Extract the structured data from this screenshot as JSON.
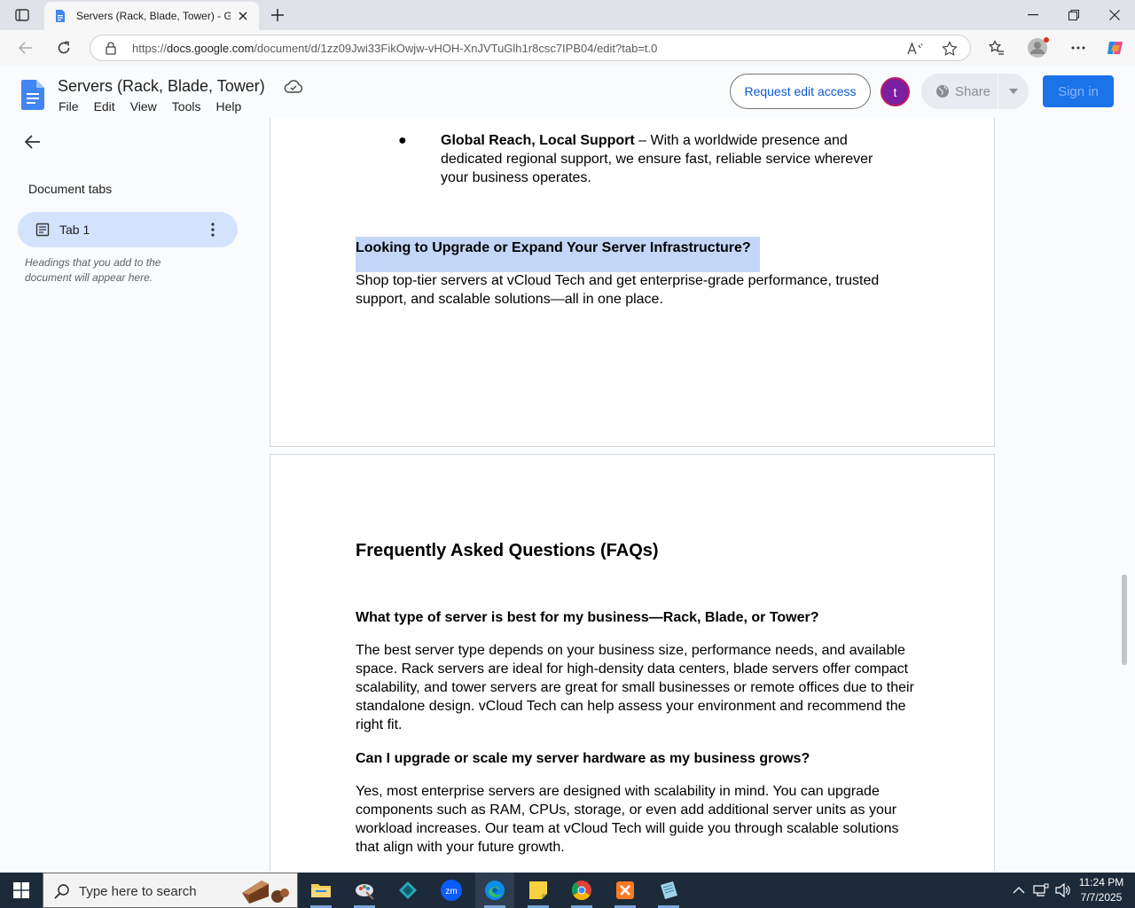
{
  "browser": {
    "tab_title": "Servers (Rack, Blade, Tower) - Goo",
    "url_prefix": "https://",
    "url_host": "docs.google.com",
    "url_path": "/document/d/1zz09Jwi33FikOwjw-vHOH-XnJVTuGlh1r8csc7IPB04/edit?tab=t.0"
  },
  "docs": {
    "title": "Servers (Rack, Blade, Tower)",
    "menu": [
      "File",
      "Edit",
      "View",
      "Tools",
      "Help"
    ],
    "request_edit_label": "Request edit access",
    "avatar_letter": "t",
    "share_label": "Share",
    "signin_label": "Sign in"
  },
  "sidebar": {
    "heading": "Document tabs",
    "tab_label": "Tab 1",
    "hint": "Headings that you add to the document will appear here."
  },
  "page1": {
    "bullet_glyph": "●",
    "bullet_bold": "Global Reach, Local Support",
    "bullet_text": " – With a worldwide presence and dedicated regional support, we ensure fast, reliable service wherever your business operates.",
    "heading": "Looking to Upgrade or Expand Your Server Infrastructure?",
    "body": "Shop top-tier servers at vCloud Tech and get enterprise-grade performance, trusted support, and scalable solutions—all in one place."
  },
  "page2": {
    "faq_title": "Frequently Asked Questions (FAQs)",
    "q1": "What type of server is best for my business—Rack, Blade, or Tower?",
    "a1": "The best server type depends on your business size, performance needs, and available space. Rack servers are ideal for high-density data centers, blade servers offer compact scalability, and tower servers are great for small businesses or remote offices due to their standalone design. vCloud Tech can help assess your environment and recommend the right fit.",
    "q2": "Can I upgrade or scale my server hardware as my business grows?",
    "a2": "Yes, most enterprise servers are designed with scalability in mind. You can upgrade components such as RAM, CPUs, storage, or even add additional server units as your workload increases. Our team at vCloud Tech will guide you through scalable solutions that align with your future growth."
  },
  "taskbar": {
    "search_placeholder": "Type here to search",
    "time": "11:24 PM",
    "date": "7/7/2025"
  },
  "colors": {
    "accent_blue": "#0b57d0",
    "selection": "#c3d6f7",
    "tab_selected": "#d3e3fd",
    "avatar": "#7b1fa2"
  }
}
